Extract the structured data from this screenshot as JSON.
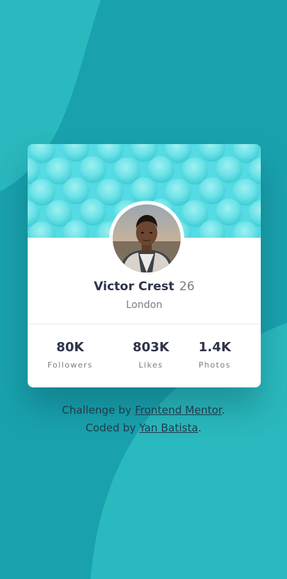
{
  "colors": {
    "background": "#19a2ae",
    "header": "#54dbe3",
    "card": "#ffffff",
    "heading_text": "#2e3349",
    "muted_text": "#7a7d86",
    "attribution_text": "#1f3a4a"
  },
  "profile": {
    "name": "Victor Crest",
    "age": "26",
    "location": "London",
    "avatar_icon": "profile-photo"
  },
  "stats": [
    {
      "value": "80K",
      "label": "Followers"
    },
    {
      "value": "803K",
      "label": "Likes"
    },
    {
      "value": "1.4K",
      "label": "Photos"
    }
  ],
  "attribution": {
    "line1_prefix": "Challenge by ",
    "line1_link": "Frontend Mentor",
    "line1_suffix": ".",
    "line2_prefix": "Coded by ",
    "line2_link": "Yan Batista",
    "line2_suffix": "."
  }
}
